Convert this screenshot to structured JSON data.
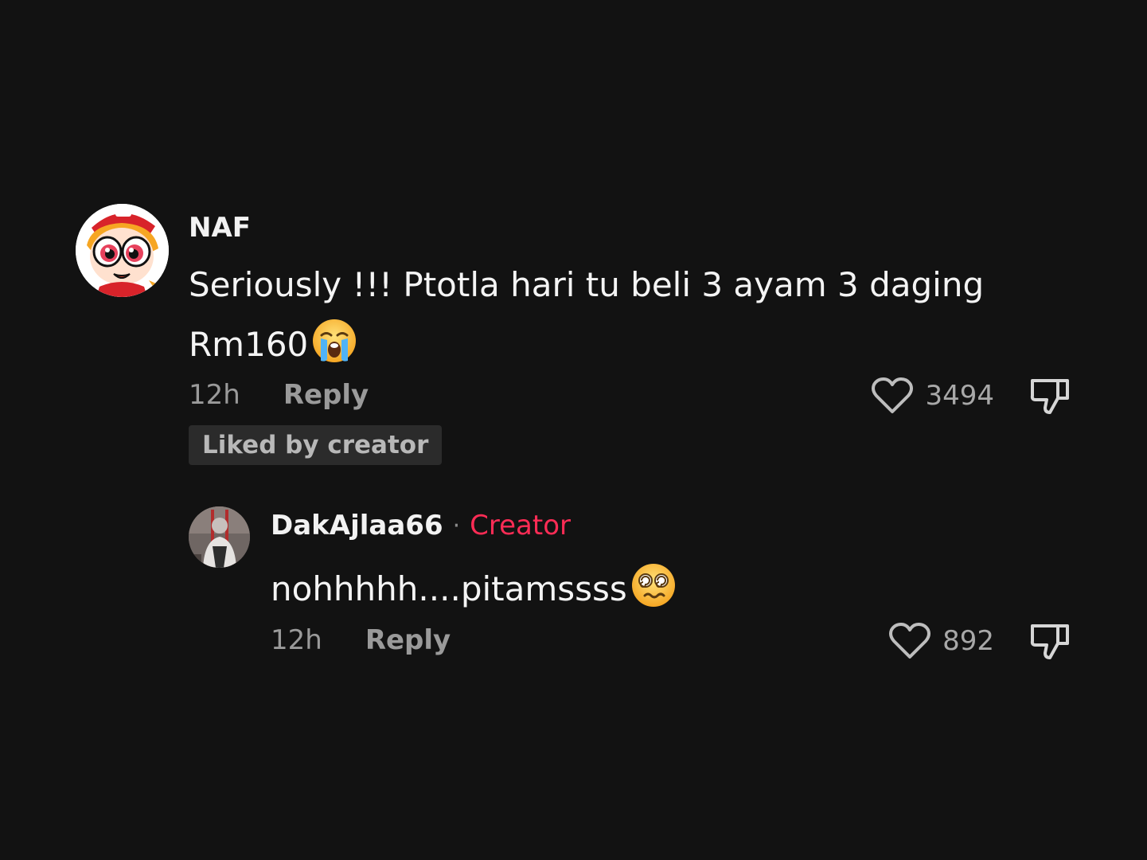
{
  "colors": {
    "background": "#121212",
    "primary_text": "#f4f4f4",
    "secondary_text": "#9a9a9a",
    "creator_accent": "#fe2c55",
    "badge_background": "#2b2b2b"
  },
  "comment": {
    "username": "NAF",
    "text_line1": "Seriously !!! Ptotla hari tu beli 3 ayam 3 daging",
    "text_line2": "Rm160",
    "emoji": "loudly-crying-face",
    "time": "12h",
    "reply_label": "Reply",
    "like_count": "3494",
    "badge": "Liked by creator",
    "avatar": "powerpuff-girl-avatar"
  },
  "reply": {
    "username": "DakAjlaa66",
    "separator": "·",
    "creator_label": "Creator",
    "text": "nohhhhh....pitamssss",
    "emoji": "dizzy-face",
    "time": "12h",
    "reply_label": "Reply",
    "like_count": "892",
    "avatar": "photo-avatar"
  },
  "icons": {
    "like": "heart-outline-icon",
    "dislike": "thumbs-down-icon"
  }
}
